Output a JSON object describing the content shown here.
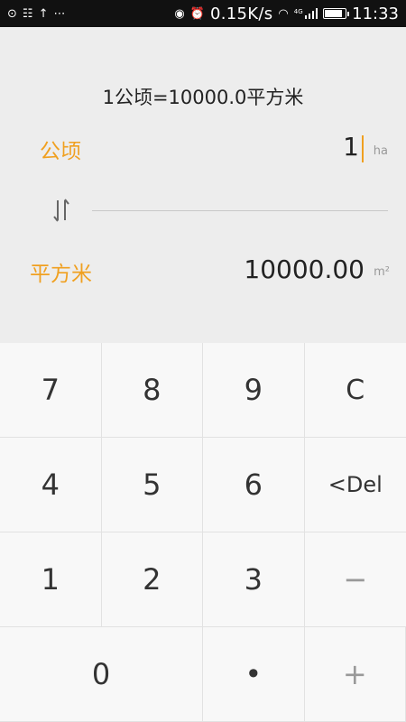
{
  "status_bar": {
    "left_icons": [
      "sim-icon",
      "qr-icon",
      "upload-icon",
      "more-icon"
    ],
    "right_icons": [
      "vibrate-icon",
      "alarm-icon",
      "wifi-icon",
      "signal-4g-icon",
      "battery-icon"
    ],
    "net_speed": "0.15K/s",
    "time": "11:33",
    "network_label": "4G",
    "battery_level": 0.85
  },
  "converter": {
    "formula": "1公顷=10000.0平方米",
    "from": {
      "unit": "公顷",
      "value": "1",
      "suffix": "ha"
    },
    "to": {
      "unit": "平方米",
      "value": "10000.00",
      "suffix": "m²"
    }
  },
  "keypad": {
    "keys": [
      {
        "label": "7",
        "name": "key-7"
      },
      {
        "label": "8",
        "name": "key-8"
      },
      {
        "label": "9",
        "name": "key-9"
      },
      {
        "label": "C",
        "name": "key-clear"
      },
      {
        "label": "4",
        "name": "key-4"
      },
      {
        "label": "5",
        "name": "key-5"
      },
      {
        "label": "6",
        "name": "key-6"
      },
      {
        "label": "<Del",
        "name": "key-delete"
      },
      {
        "label": "1",
        "name": "key-1"
      },
      {
        "label": "2",
        "name": "key-2"
      },
      {
        "label": "3",
        "name": "key-3"
      },
      {
        "label": "−",
        "name": "key-minus"
      },
      {
        "label": "0",
        "name": "key-0"
      },
      {
        "label": "•",
        "name": "key-decimal"
      },
      {
        "label": "+",
        "name": "key-plus"
      }
    ]
  },
  "colors": {
    "accent": "#f0a020",
    "panel_bg": "#ededed",
    "keypad_bg": "#f8f8f8"
  }
}
